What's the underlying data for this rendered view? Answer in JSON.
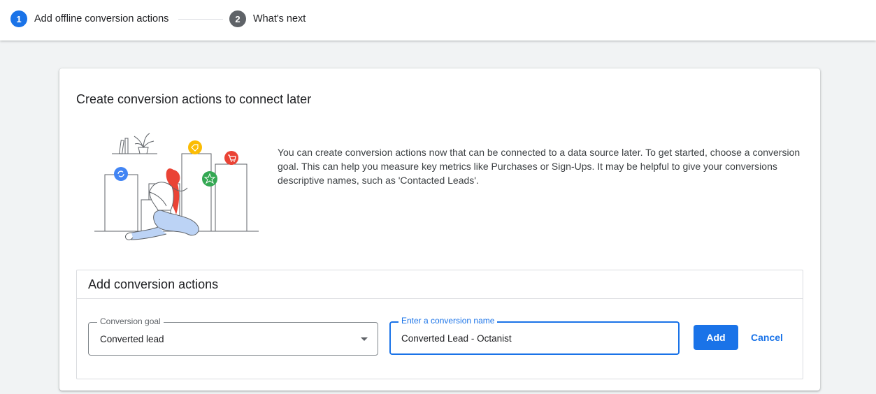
{
  "stepper": {
    "steps": [
      {
        "number": "1",
        "label": "Add offline conversion actions",
        "color": "#1a73e8"
      },
      {
        "number": "2",
        "label": "What's next",
        "color": "#5f6368"
      }
    ]
  },
  "card": {
    "title": "Create conversion actions to connect later",
    "description": "You can create conversion actions now that can be connected to a data source later. To get started, choose a conversion goal. This can help you measure key metrics like Purchases or Sign-Ups. It may be helpful to give your conversions descriptive names, such as 'Contacted Leads'.",
    "illustration": {
      "icons": [
        "sync-icon",
        "tag-icon",
        "cart-icon",
        "star-icon"
      ],
      "colors": {
        "blue": "#4285f4",
        "yellow": "#fbbc04",
        "red": "#ea4335",
        "green": "#34a853"
      }
    }
  },
  "panel": {
    "title": "Add conversion actions",
    "goal_field": {
      "label": "Conversion goal",
      "value": "Converted lead"
    },
    "name_field": {
      "label": "Enter a conversion name",
      "value": "Converted Lead - Octanist"
    },
    "add_label": "Add",
    "cancel_label": "Cancel"
  },
  "colors": {
    "accent": "#1a73e8",
    "text": "#202124",
    "border": "#dadce0",
    "background": "#f1f3f4"
  }
}
